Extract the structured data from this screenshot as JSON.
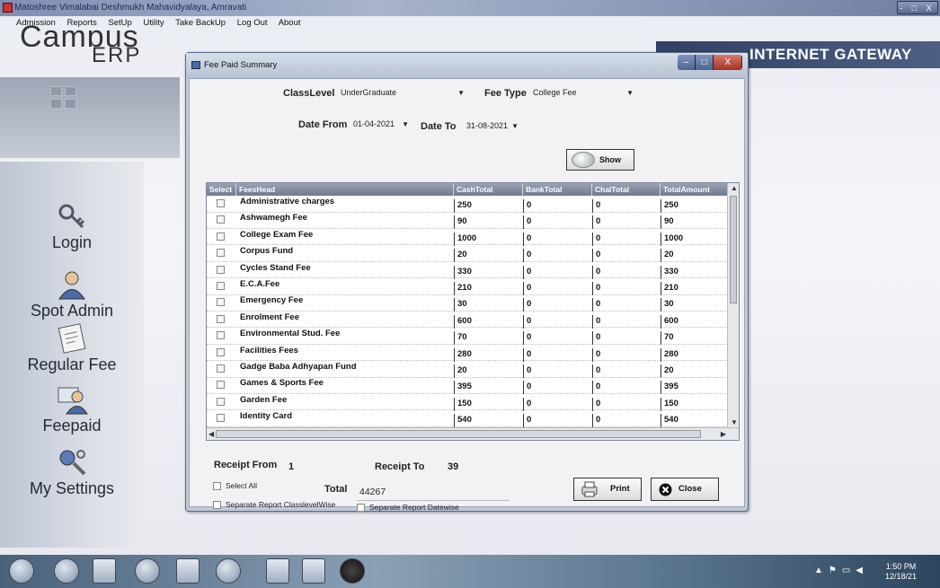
{
  "window": {
    "title": "Matoshree Vimalabai Deshmukh Mahavidyalaya, Amravati",
    "controls": "- □ X"
  },
  "menu": [
    "Admission",
    "Reports",
    "SetUp",
    "Utility",
    "Take BackUp",
    "Log Out",
    "About"
  ],
  "branding": {
    "logo_top": "Campus",
    "logo_bottom": "ERP",
    "banner": "INTERNET GATEWAY"
  },
  "sidebar": {
    "items": [
      {
        "label": "Login",
        "icon": "key-icon"
      },
      {
        "label": "Spot Admin",
        "icon": "user-icon"
      },
      {
        "label": "Regular Fee",
        "icon": "document-icon"
      },
      {
        "label": "Feepaid",
        "icon": "users-icon"
      },
      {
        "label": "My Settings",
        "icon": "tools-icon"
      }
    ]
  },
  "dialog": {
    "title": "Fee Paid Summary",
    "class_level_label": "ClassLevel",
    "class_level_value": "UnderGraduate",
    "fee_type_label": "Fee Type",
    "fee_type_value": "College Fee",
    "date_from_label": "Date From",
    "date_from_value": "01-04-2021",
    "date_to_label": "Date To",
    "date_to_value": "31-08-2021",
    "show_label": "Show",
    "columns": [
      "Select",
      "FeesHead",
      "CashTotal",
      "BankTotal",
      "ChalTotal",
      "TotalAmount"
    ],
    "rows": [
      {
        "head": "Administrative charges",
        "cash": "250",
        "bank": "0",
        "chal": "0",
        "total": "250"
      },
      {
        "head": "Ashwamegh Fee",
        "cash": "90",
        "bank": "0",
        "chal": "0",
        "total": "90"
      },
      {
        "head": "College Exam Fee",
        "cash": "1000",
        "bank": "0",
        "chal": "0",
        "total": "1000"
      },
      {
        "head": "Corpus Fund",
        "cash": "20",
        "bank": "0",
        "chal": "0",
        "total": "20"
      },
      {
        "head": "Cycles Stand Fee",
        "cash": "330",
        "bank": "0",
        "chal": "0",
        "total": "330"
      },
      {
        "head": "E.C.A.Fee",
        "cash": "210",
        "bank": "0",
        "chal": "0",
        "total": "210"
      },
      {
        "head": "Emergency Fee",
        "cash": "30",
        "bank": "0",
        "chal": "0",
        "total": "30"
      },
      {
        "head": "Enrolment Fee",
        "cash": "600",
        "bank": "0",
        "chal": "0",
        "total": "600"
      },
      {
        "head": "Environmental Stud. Fee",
        "cash": "70",
        "bank": "0",
        "chal": "0",
        "total": "70"
      },
      {
        "head": "Facilities Fees",
        "cash": "280",
        "bank": "0",
        "chal": "0",
        "total": "280"
      },
      {
        "head": "Gadge Baba Adhyapan Fund",
        "cash": "20",
        "bank": "0",
        "chal": "0",
        "total": "20"
      },
      {
        "head": "Games & Sports Fee",
        "cash": "395",
        "bank": "0",
        "chal": "0",
        "total": "395"
      },
      {
        "head": "Garden Fee",
        "cash": "150",
        "bank": "0",
        "chal": "0",
        "total": "150"
      },
      {
        "head": "Identity Card",
        "cash": "540",
        "bank": "0",
        "chal": "0",
        "total": "540"
      }
    ],
    "receipt_from_label": "Receipt From",
    "receipt_from_value": "1",
    "receipt_to_label": "Receipt To",
    "receipt_to_value": "39",
    "select_all_label": "Select All",
    "total_label": "Total",
    "total_value": "44267",
    "separate_classlevel_label": "Separate Report ClasslevelWise",
    "separate_datewise_label": "Separate Report Datewise",
    "print_label": "Print",
    "close_label": "Close"
  },
  "taskbar": {
    "time": "1:50 PM",
    "date": "12/18/21"
  }
}
